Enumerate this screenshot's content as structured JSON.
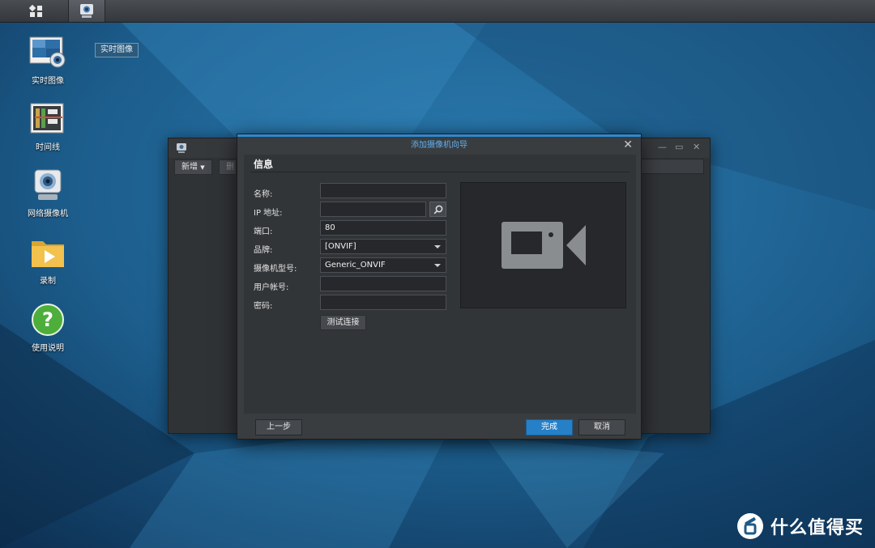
{
  "desktop": {
    "tooltip": "实时图像",
    "icons": [
      {
        "label": "实时图像",
        "icon": "live-view-icon"
      },
      {
        "label": "时间线",
        "icon": "timeline-icon"
      },
      {
        "label": "网络摄像机",
        "icon": "ip-camera-icon"
      },
      {
        "label": "录制",
        "icon": "recording-folder-icon"
      },
      {
        "label": "使用说明",
        "icon": "help-icon"
      }
    ]
  },
  "taskbar": {
    "items": [
      "main-menu-icon",
      "surveillance-app-icon"
    ]
  },
  "bg_window": {
    "toolbar": {
      "add_label": "新增",
      "second_label": "删除"
    }
  },
  "dialog": {
    "title": "添加摄像机向导",
    "section_title": "信息",
    "fields": {
      "name": {
        "label": "名称:",
        "value": ""
      },
      "ip": {
        "label": "IP 地址:",
        "value": ""
      },
      "port": {
        "label": "端口:",
        "value": "80"
      },
      "brand": {
        "label": "品牌:",
        "value": "[ONVIF]"
      },
      "model": {
        "label": "摄像机型号:",
        "value": "Generic_ONVIF"
      },
      "username": {
        "label": "用户帐号:",
        "value": ""
      },
      "password": {
        "label": "密码:",
        "value": ""
      }
    },
    "test_button": "测试连接",
    "preview_icon": "video-camera-icon",
    "footer": {
      "prev": "上一步",
      "finish": "完成",
      "cancel": "取消"
    }
  },
  "watermark": {
    "text": "什么值得买",
    "logo": "smzdm-logo"
  },
  "colors": {
    "accent": "#2a8ad8",
    "finish_button": "#2580c8",
    "dialog_bg": "#3a3d40"
  }
}
